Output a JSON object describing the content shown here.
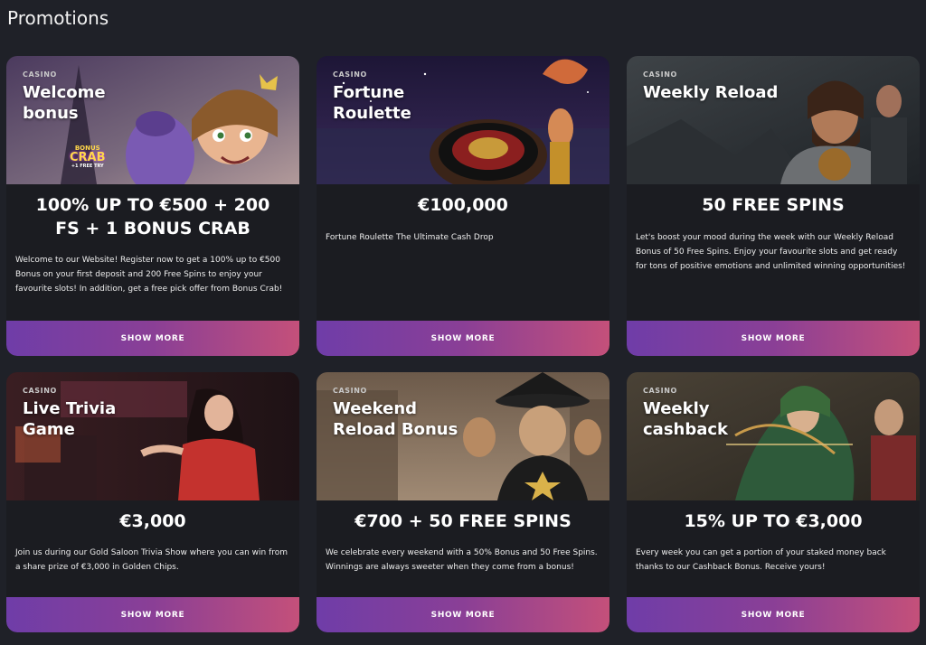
{
  "page": {
    "title": "Promotions"
  },
  "cards": [
    {
      "category": "CASINO",
      "title": "Welcome bonus",
      "headline": "100% UP TO €500 + 200 FS + 1 BONUS CRAB",
      "description": "Welcome to our Website! Register now to get a 100% up to €500 Bonus on your first deposit and 200 Free Spins to enjoy your favourite slots! In addition, get a free pick offer from Bonus Crab!",
      "button": "SHOW MORE",
      "badge": {
        "line1": "BONUS",
        "line2": "CRAB",
        "line3": "+1 FREE TRY"
      }
    },
    {
      "category": "CASINO",
      "title": "Fortune Roulette",
      "headline": "€100,000",
      "description": "Fortune Roulette The Ultimate Cash Drop",
      "button": "SHOW MORE"
    },
    {
      "category": "CASINO",
      "title": "Weekly Reload",
      "headline": "50 FREE SPINS",
      "description": "Let's boost your mood during the week with our Weekly Reload Bonus of 50 Free Spins. Enjoy your favourite slots and get ready for tons of positive emotions and unlimited winning opportunities!",
      "button": "SHOW MORE"
    },
    {
      "category": "CASINO",
      "title": "Live Trivia Game",
      "headline": "€3,000",
      "description": "Join us during our Gold Saloon Trivia Show where you can win from a share prize of €3,000 in Golden Chips.",
      "button": "SHOW MORE"
    },
    {
      "category": "CASINO",
      "title": "Weekend Reload Bonus",
      "headline": "€700 + 50 FREE SPINS",
      "description": "We celebrate every weekend with a 50% Bonus and 50 Free Spins. Winnings are always sweeter when they come from a bonus!",
      "button": "SHOW MORE"
    },
    {
      "category": "CASINO",
      "title": "Weekly cashback",
      "headline": "15% UP TO €3,000",
      "description": "Every week you can get a portion of your staked money back thanks to our Cashback Bonus. Receive yours!",
      "button": "SHOW MORE"
    }
  ]
}
